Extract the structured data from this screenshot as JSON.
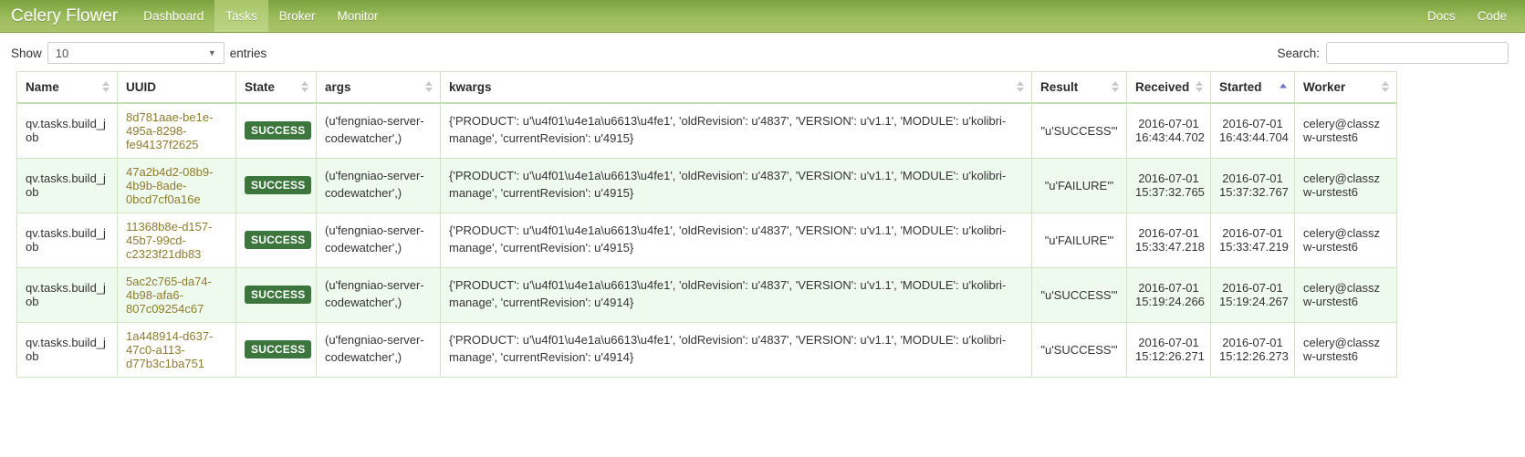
{
  "navbar": {
    "brand": "Celery Flower",
    "links": [
      {
        "label": "Dashboard",
        "active": false
      },
      {
        "label": "Tasks",
        "active": true
      },
      {
        "label": "Broker",
        "active": false
      },
      {
        "label": "Monitor",
        "active": false
      }
    ],
    "right_links": [
      {
        "label": "Docs"
      },
      {
        "label": "Code"
      }
    ],
    "gradient_top": "#7aa33f",
    "gradient_bottom": "#a9c46a",
    "active_bg": "#b3cb78"
  },
  "controls": {
    "show_label": "Show",
    "entries_label": "entries",
    "page_length_value": "10",
    "caret_icon": "chevron-down-icon",
    "search_label": "Search:",
    "search_value": "",
    "search_placeholder": ""
  },
  "table": {
    "columns": [
      {
        "key": "name",
        "label": "Name",
        "sort": "none"
      },
      {
        "key": "uuid",
        "label": "UUID",
        "sort": "unsortable"
      },
      {
        "key": "state",
        "label": "State",
        "sort": "none"
      },
      {
        "key": "args",
        "label": "args",
        "sort": "none"
      },
      {
        "key": "kwargs",
        "label": "kwargs",
        "sort": "none"
      },
      {
        "key": "result",
        "label": "Result",
        "sort": "none"
      },
      {
        "key": "received",
        "label": "Received",
        "sort": "none"
      },
      {
        "key": "started",
        "label": "Started",
        "sort": "asc"
      },
      {
        "key": "worker",
        "label": "Worker",
        "sort": "none"
      }
    ],
    "rows": [
      {
        "name": "qv.tasks.build_job",
        "uuid": "8d781aae-be1e-495a-8298-fe94137f2625",
        "state": "SUCCESS",
        "args": "(u'fengniao-server-codewatcher',)",
        "kwargs": "{'PRODUCT': u'\\u4f01\\u4e1a\\u6613\\u4fe1', 'oldRevision': u'4837', 'VERSION': u'v1.1', 'MODULE': u'kolibri-manage', 'currentRevision': u'4915}",
        "result": "\"u'SUCCESS'\"",
        "received_date": "2016-07-01",
        "received_time": "16:43:44.702",
        "started_date": "2016-07-01",
        "started_time": "16:43:44.704",
        "worker": "celery@classzw-urstest6"
      },
      {
        "name": "qv.tasks.build_job",
        "uuid": "47a2b4d2-08b9-4b9b-8ade-0bcd7cf0a16e",
        "state": "SUCCESS",
        "args": "(u'fengniao-server-codewatcher',)",
        "kwargs": "{'PRODUCT': u'\\u4f01\\u4e1a\\u6613\\u4fe1', 'oldRevision': u'4837', 'VERSION': u'v1.1', 'MODULE': u'kolibri-manage', 'currentRevision': u'4915}",
        "result": "\"u'FAILURE'\"",
        "received_date": "2016-07-01",
        "received_time": "15:37:32.765",
        "started_date": "2016-07-01",
        "started_time": "15:37:32.767",
        "worker": "celery@classzw-urstest6"
      },
      {
        "name": "qv.tasks.build_job",
        "uuid": "11368b8e-d157-45b7-99cd-c2323f21db83",
        "state": "SUCCESS",
        "args": "(u'fengniao-server-codewatcher',)",
        "kwargs": "{'PRODUCT': u'\\u4f01\\u4e1a\\u6613\\u4fe1', 'oldRevision': u'4837', 'VERSION': u'v1.1', 'MODULE': u'kolibri-manage', 'currentRevision': u'4915}",
        "result": "\"u'FAILURE'\"",
        "received_date": "2016-07-01",
        "received_time": "15:33:47.218",
        "started_date": "2016-07-01",
        "started_time": "15:33:47.219",
        "worker": "celery@classzw-urstest6"
      },
      {
        "name": "qv.tasks.build_job",
        "uuid": "5ac2c765-da74-4b98-afa6-807c09254c67",
        "state": "SUCCESS",
        "args": "(u'fengniao-server-codewatcher',)",
        "kwargs": "{'PRODUCT': u'\\u4f01\\u4e1a\\u6613\\u4fe1', 'oldRevision': u'4837', 'VERSION': u'v1.1', 'MODULE': u'kolibri-manage', 'currentRevision': u'4914}",
        "result": "\"u'SUCCESS'\"",
        "received_date": "2016-07-01",
        "received_time": "15:19:24.266",
        "started_date": "2016-07-01",
        "started_time": "15:19:24.267",
        "worker": "celery@classzw-urstest6"
      },
      {
        "name": "qv.tasks.build_job",
        "uuid": "1a448914-d637-47c0-a113-d77b3c1ba751",
        "state": "SUCCESS",
        "args": "(u'fengniao-server-codewatcher',)",
        "kwargs": "{'PRODUCT': u'\\u4f01\\u4e1a\\u6613\\u4fe1', 'oldRevision': u'4837', 'VERSION': u'v1.1', 'MODULE': u'kolibri-manage', 'currentRevision': u'4914}",
        "result": "\"u'SUCCESS'\"",
        "received_date": "2016-07-01",
        "received_time": "15:12:26.271",
        "started_date": "2016-07-01",
        "started_time": "15:12:26.273",
        "worker": "celery@classzw-urstest6"
      }
    ]
  },
  "colors": {
    "badge_success": "#3c763d",
    "link_uuid": "#8f7b2d",
    "row_alt": "#eefaee",
    "border": "#cfe6c2",
    "sort_active": "#6f72d4"
  }
}
